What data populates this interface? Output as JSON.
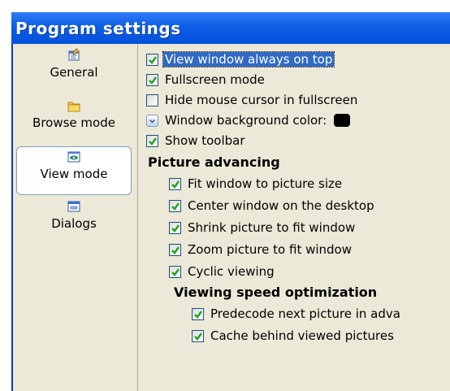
{
  "window": {
    "title": "Program settings"
  },
  "sidebar": {
    "items": [
      {
        "label": "General",
        "icon": "general-settings-icon"
      },
      {
        "label": "Browse mode",
        "icon": "folder-icon"
      },
      {
        "label": "View mode",
        "icon": "view-window-icon",
        "selected": true
      },
      {
        "label": "Dialogs",
        "icon": "dialog-window-icon"
      }
    ]
  },
  "view_mode": {
    "options": [
      {
        "label": "View window always on top",
        "checked": true
      },
      {
        "label": "Fullscreen mode",
        "checked": true
      },
      {
        "label": "Hide mouse cursor in fullscreen",
        "checked": false
      }
    ],
    "background_color": {
      "label": "Window background color:",
      "value": "#000000"
    },
    "show_toolbar": {
      "label": "Show toolbar",
      "checked": true
    },
    "picture_advancing": {
      "heading": "Picture advancing",
      "options": [
        {
          "label": "Fit window to picture size",
          "checked": true
        },
        {
          "label": "Center window on the desktop",
          "checked": true
        },
        {
          "label": "Shrink picture to fit window",
          "checked": true
        },
        {
          "label": "Zoom picture to fit window",
          "checked": true
        },
        {
          "label": "Cyclic viewing",
          "checked": true
        }
      ]
    },
    "speed_optimization": {
      "heading": "Viewing speed optimization",
      "options": [
        {
          "label": "Predecode next picture in adva",
          "checked": true
        },
        {
          "label": "Cache behind viewed pictures",
          "checked": true
        }
      ]
    }
  },
  "colors": {
    "title_bar": "#0a58e2",
    "panel": "#ece9d8",
    "check": "#21a121",
    "selection": "#316ac5"
  }
}
